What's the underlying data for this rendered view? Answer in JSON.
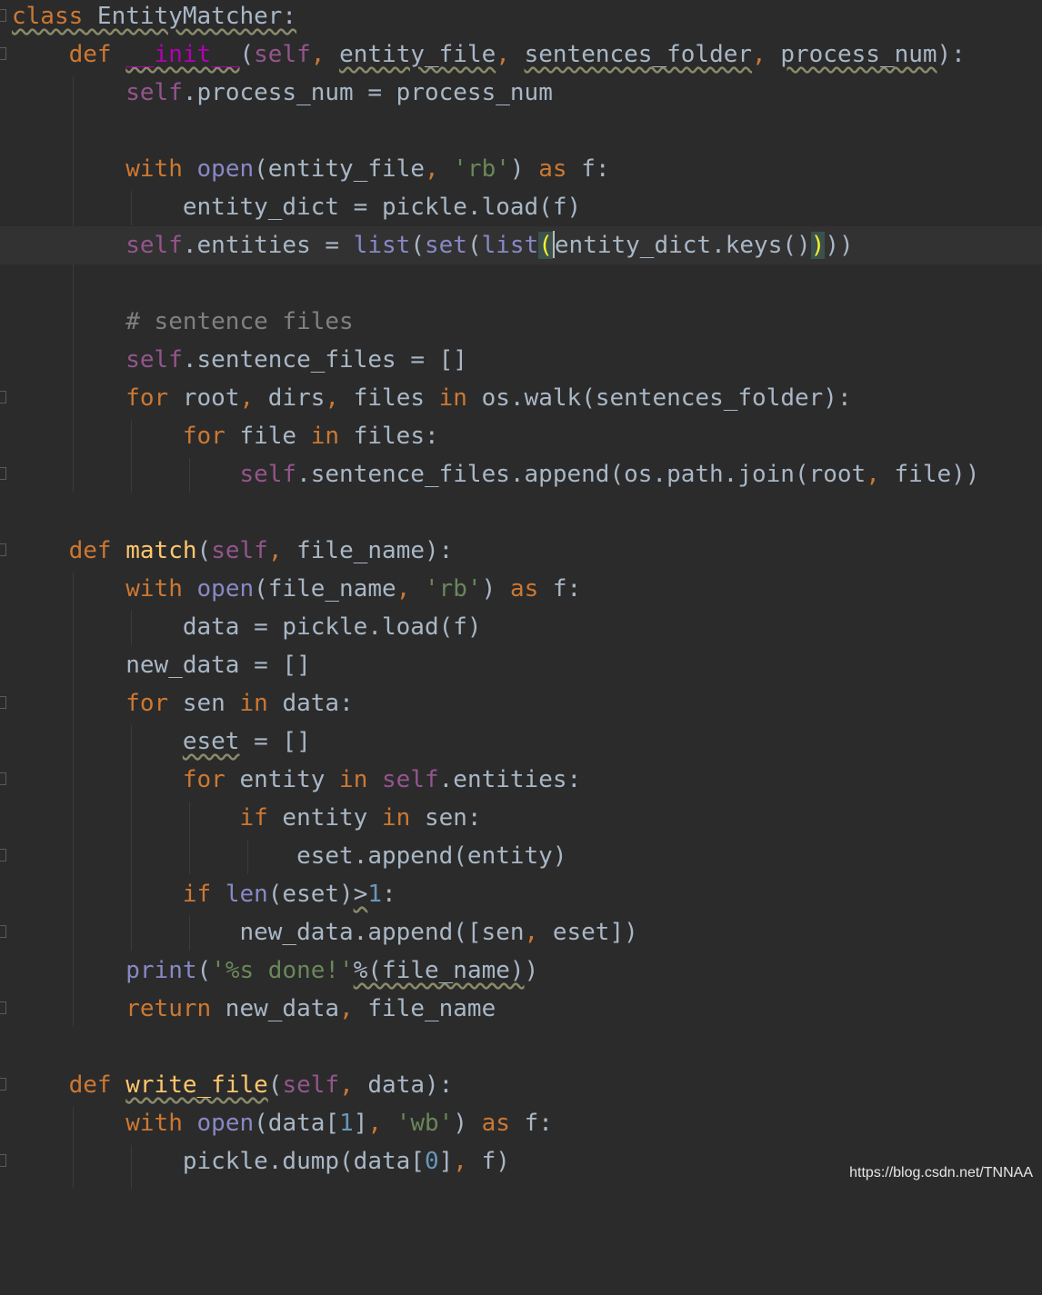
{
  "colors": {
    "background": "#2b2b2b",
    "current_line": "#323232",
    "default_text": "#a9b7c6",
    "keyword": "#cc7832",
    "self": "#94558d",
    "function_name": "#ffc66d",
    "builtin": "#8888c6",
    "string": "#6a8759",
    "number": "#6897bb",
    "comment": "#808080"
  },
  "code": {
    "l01": [
      "class",
      " EntityMatcher:"
    ],
    "l02": [
      "def",
      " ",
      "__init__",
      "(",
      "self",
      ", ",
      "entity_file",
      ", ",
      "sentences_folder",
      ", ",
      "process_num",
      "):"
    ],
    "l03": [
      "self",
      ".process_num = process_num"
    ],
    "l05": [
      "with",
      " ",
      "open",
      "(entity_file",
      ", ",
      "'rb'",
      ") ",
      "as",
      " f:"
    ],
    "l06": [
      "entity_dict = pickle.load(f)"
    ],
    "l07": [
      "self",
      ".entities = ",
      "list",
      "(",
      "set",
      "(",
      "list",
      "(",
      "",
      "entity_dict.keys()",
      ")",
      "))"
    ],
    "l09": [
      "# sentence files"
    ],
    "l10": [
      "self",
      ".sentence_files = []"
    ],
    "l11": [
      "for",
      " root",
      ", ",
      "dirs",
      ", ",
      "files ",
      "in",
      " os.walk(sentences_folder):"
    ],
    "l12": [
      "for",
      " file ",
      "in",
      " files:"
    ],
    "l13": [
      "self",
      ".sentence_files.append(os.path.join(root",
      ", ",
      "file))"
    ],
    "l15": [
      "def",
      " ",
      "match",
      "(",
      "self",
      ", ",
      "file_name):"
    ],
    "l16": [
      "with",
      " ",
      "open",
      "(file_name",
      ", ",
      "'rb'",
      ") ",
      "as",
      " f:"
    ],
    "l17": [
      "data = pickle.load(f)"
    ],
    "l18": [
      "new_data = []"
    ],
    "l19": [
      "for",
      " sen ",
      "in",
      " data:"
    ],
    "l20": [
      "eset",
      " = []"
    ],
    "l21": [
      "for",
      " entity ",
      "in",
      " ",
      "self",
      ".entities:"
    ],
    "l22": [
      "if",
      " entity ",
      "in",
      " sen:"
    ],
    "l23": [
      "eset.append(entity)"
    ],
    "l24": [
      "if",
      " ",
      "len",
      "(eset)",
      ">",
      "1",
      ":"
    ],
    "l25": [
      "new_data.append([sen",
      ", ",
      "eset])"
    ],
    "l26": [
      "print",
      "(",
      "'%s done!'",
      "%(file_name)",
      ")"
    ],
    "l27": [
      "return",
      " new_data",
      ", ",
      "file_name"
    ],
    "l29": [
      "def",
      " ",
      "write_file",
      "(",
      "self",
      ", ",
      "data):"
    ],
    "l30": [
      "with",
      " ",
      "open",
      "(data[",
      "1",
      "]",
      ", ",
      "'wb'",
      ") ",
      "as",
      " f:"
    ],
    "l31": [
      "pickle.dump(data[",
      "0",
      "]",
      ", ",
      "f)"
    ]
  },
  "watermark": "https://blog.csdn.net/TNNAA"
}
